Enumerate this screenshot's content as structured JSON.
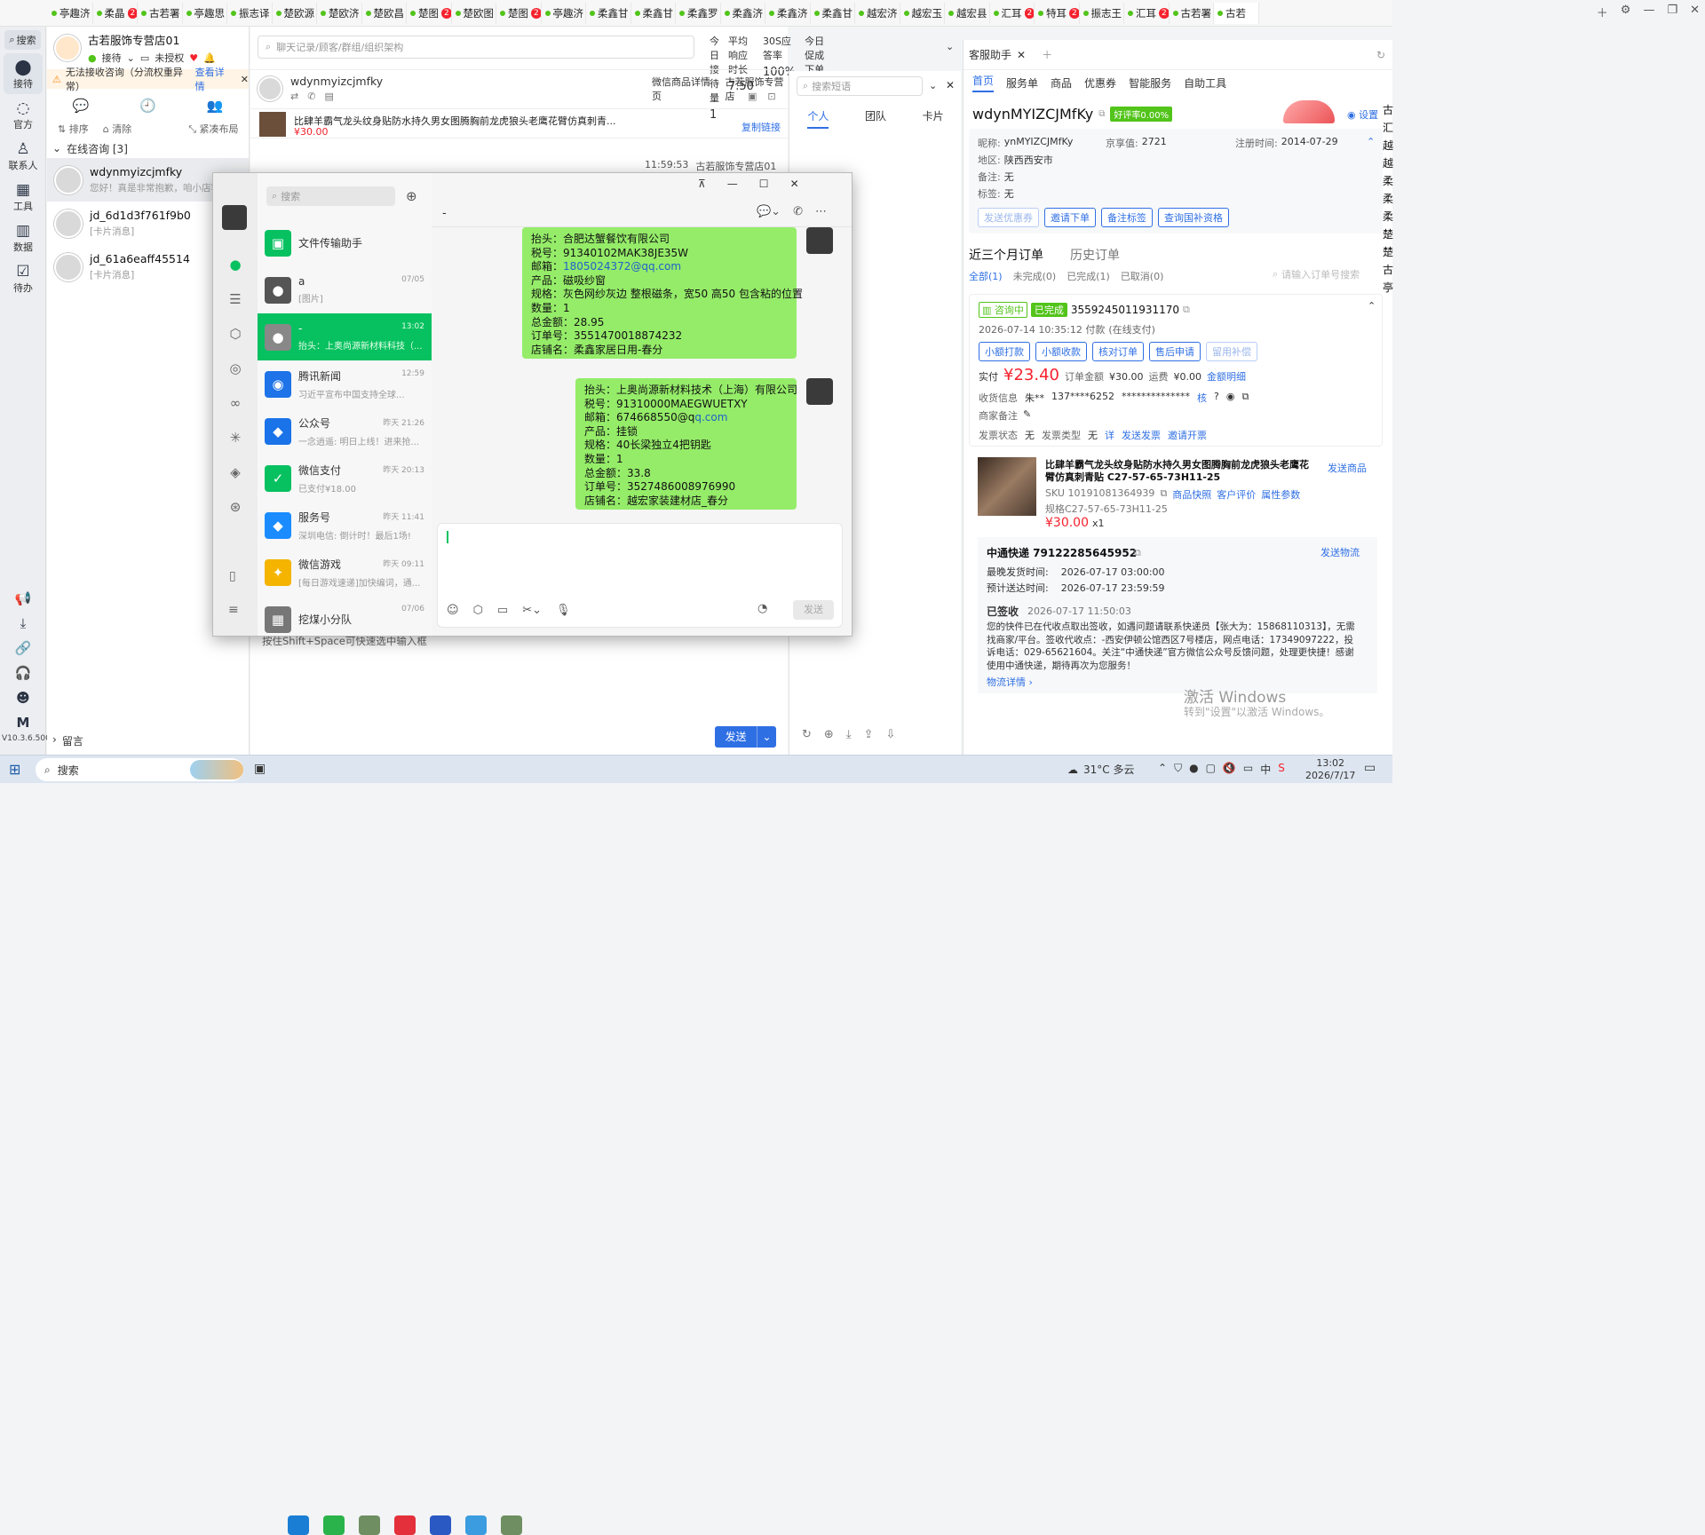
{
  "tabs": [
    {
      "label": "亭趣济",
      "badge": ""
    },
    {
      "label": "柔晶",
      "badge": "2"
    },
    {
      "label": "古若署",
      "badge": ""
    },
    {
      "label": "亭趣思",
      "badge": ""
    },
    {
      "label": "振志译",
      "badge": ""
    },
    {
      "label": "楚欧源",
      "badge": ""
    },
    {
      "label": "楚欧济",
      "badge": ""
    },
    {
      "label": "楚欧昌",
      "badge": ""
    },
    {
      "label": "楚图",
      "badge": "2"
    },
    {
      "label": "楚欧图",
      "badge": ""
    },
    {
      "label": "楚图",
      "badge": "2"
    },
    {
      "label": "亭趣济",
      "badge": ""
    },
    {
      "label": "柔鑫甘",
      "badge": ""
    },
    {
      "label": "柔鑫甘",
      "badge": ""
    },
    {
      "label": "柔鑫罗",
      "badge": ""
    },
    {
      "label": "柔鑫济",
      "badge": ""
    },
    {
      "label": "柔鑫济",
      "badge": ""
    },
    {
      "label": "柔鑫甘",
      "badge": ""
    },
    {
      "label": "越宏济",
      "badge": ""
    },
    {
      "label": "越宏玉",
      "badge": ""
    },
    {
      "label": "越宏县",
      "badge": ""
    },
    {
      "label": "汇耳",
      "badge": "2"
    },
    {
      "label": "特耳",
      "badge": "2"
    },
    {
      "label": "振志王",
      "badge": ""
    },
    {
      "label": "汇耳",
      "badge": "2"
    },
    {
      "label": "古若署",
      "badge": ""
    },
    {
      "label": "古若",
      "badge": ""
    }
  ],
  "leftnav": {
    "search": "搜索",
    "items": [
      "接待",
      "官方",
      "联系人",
      "工具",
      "数据",
      "待办"
    ],
    "version": "V10.3.6.500"
  },
  "shop": {
    "name": "古若服饰专营店01",
    "status": "接待",
    "auth": "未授权",
    "alert": "无法接收咨询（分流权重异常）",
    "alert_link": "查看详情",
    "sort": "排序",
    "clear": "清除",
    "layout": "紧凑布局",
    "section": "在线咨询 [3]",
    "leave": "留言"
  },
  "conversations": [
    {
      "name": "wdynmyizcjmfky",
      "preview": "您好！真是非常抱歉，咱小店客"
    },
    {
      "name": "jd_6d1d3f761f9b0",
      "preview": "[卡片消息]"
    },
    {
      "name": "jd_61a6eaff45514",
      "preview": "[卡片消息]"
    }
  ],
  "chat": {
    "search_placeholder": "聊天记录/顾客/群组/组织架构",
    "user": "wdynmyizcjmfky",
    "link1": "微信商品详情页",
    "link2": "古若服饰专营店",
    "product_title": "比肆羊霸气龙头纹身贴防水持久男女图腾胸前龙虎狼头老鹰花臂仿真刺青...",
    "product_price": "¥30.00",
    "copy_link": "复制链接",
    "time": "11:59:53",
    "sender": "古若服饰专营店01",
    "hint": "按住Shift+Space可快速选中输入框",
    "send": "发送"
  },
  "stats": [
    {
      "label": "今日接待量",
      "value": "1"
    },
    {
      "label": "平均响应时长",
      "value": "7.50"
    },
    {
      "label": "30S应答率",
      "value": "100%"
    },
    {
      "label": "今日促成下单金额",
      "value": "0.00"
    }
  ],
  "quick": {
    "placeholder": "搜索短语",
    "tabs": [
      "个人",
      "团队",
      "卡片"
    ]
  },
  "assistant": {
    "tab": "客服助手",
    "nav": [
      "首页",
      "服务单",
      "商品",
      "优惠券",
      "智能服务",
      "自助工具"
    ],
    "settings": "设置",
    "customer": "wdynMYIZCJMfKy",
    "rate": "好评率0.00%",
    "nick_label": "昵称:",
    "nick": "ynMYIZCJMfKy",
    "jx_label": "京享值:",
    "jx": "2721",
    "reg_label": "注册时间:",
    "reg": "2014-07-29",
    "area_label": "地区:",
    "area": "陕西西安市",
    "note_label": "备注:",
    "note": "无",
    "tag_label": "标签:",
    "tag": "无",
    "buttons": [
      "发送优惠券",
      "邀请下单",
      "备注标签",
      "查询国补资格"
    ],
    "orders_tab": "近三个月订单",
    "history_tab": "历史订单",
    "filters": [
      "全部(1)",
      "未完成(0)",
      "已完成(1)",
      "已取消(0)"
    ],
    "order_search": "请输入订单号搜索",
    "consult": "咨询中",
    "done": "已完成",
    "order_no": "3559245011931170",
    "order_time": "2026-07-14 10:35:12 付款",
    "order_pay": "(在线支付)",
    "order_btns": [
      "小额打款",
      "小额收款",
      "核对订单",
      "售后申请",
      "留用补偿"
    ],
    "paid_label": "实付",
    "paid": "¥23.40",
    "amount_label": "订单金额",
    "amount": "¥30.00",
    "ship_label": "运费",
    "ship": "¥0.00",
    "detail": "金额明细",
    "recv_label": "收货信息",
    "recv_name": "朱**",
    "recv_phone": "137****6252",
    "recv_addr": "**************",
    "merchant_note": "商家备注",
    "inv_status_label": "发票状态",
    "inv_status": "无",
    "inv_type_label": "发票类型",
    "inv_type": "无",
    "inv_send": "发送发票",
    "inv_invite": "邀请开票",
    "item_title": "比肆羊霸气龙头纹身贴防水持久男女图腾胸前龙虎狼头老鹰花臂仿真刺青贴 C27-57-65-73H11-25",
    "send_item": "发送商品",
    "sku": "SKU 10191081364939",
    "snap": "商品快照",
    "review": "客户评价",
    "attr": "属性参数",
    "spec": "规格C27-57-65-73H11-25",
    "item_price": "¥30.00",
    "qty": "x1",
    "express": "中通快递 79122285645952",
    "send_logistics": "发送物流",
    "latest_ship_label": "最晚发货时间:",
    "latest_ship": "2026-07-17 03:00:00",
    "eta_label": "预计送达时间:",
    "eta": "2026-07-17 23:59:59",
    "signed": "已签收",
    "signed_time": "2026-07-17 11:50:03",
    "signed_text": "您的快件已在代收点取出签收，如遇问题请联系快递员【张大为：15868110313】，无需找商家/平台。签收代收点：-西安伊顿公馆西区7号楼店，网点电话：17349097222，投诉电话：029-65621604。关注“中通快递”官方微信公众号反馈问题，处理更快捷！感谢使用中通快递，期待再次为您服务！",
    "logistics_detail": "物流详情"
  },
  "right_edge": [
    "古",
    "汇",
    "越",
    "越",
    "柔",
    "柔",
    "柔",
    "楚",
    "楚",
    "古",
    "亭"
  ],
  "wechat": {
    "search": "搜索",
    "chat_title": "-",
    "list": [
      {
        "name": "文件传输助手",
        "time": "",
        "preview": "",
        "color": "#07c160",
        "glyph": "▣"
      },
      {
        "name": "a",
        "time": "07/05",
        "preview": "[图片]",
        "color": "#555",
        "glyph": "●"
      },
      {
        "name": "-",
        "time": "13:02",
        "preview": "抬头：上奥尚源新材料科技（...",
        "color": "#888",
        "glyph": "●"
      },
      {
        "name": "腾讯新闻",
        "time": "12:59",
        "preview": "习近平宣布中国支持全球...",
        "color": "#1e73e8",
        "glyph": "◉"
      },
      {
        "name": "公众号",
        "time": "昨天 21:26",
        "preview": "一念逍遥: 明日上线！进来抢...",
        "color": "#1a73e8",
        "glyph": "◆"
      },
      {
        "name": "微信支付",
        "time": "昨天 20:13",
        "preview": "已支付¥18.00",
        "color": "#07c160",
        "glyph": "✓"
      },
      {
        "name": "服务号",
        "time": "昨天 11:41",
        "preview": "深圳电信: 倒计时！最后1场!",
        "color": "#1a8cff",
        "glyph": "◆"
      },
      {
        "name": "微信游戏",
        "time": "昨天 09:11",
        "preview": "[每日游戏速递]加快编词，通...",
        "color": "#f4b400",
        "glyph": "✦"
      },
      {
        "name": "挖煤小分队",
        "time": "07/06",
        "preview": "",
        "color": "#777",
        "glyph": "▦"
      }
    ],
    "msg1": [
      "抬头：合肥达蟹餐饮有限公司",
      "税号：91340102MAK38JE35W",
      "邮箱：",
      "产品：磁吸纱窗",
      "规格：灰色网纱灰边 整根磁条，宽50 高50 包含粘的位置",
      "数量：1",
      "总金额：28.95",
      "订单号：3551470018874232",
      "店铺名：柔鑫家居日用-春分"
    ],
    "msg1_email": "1805024372@qq.com",
    "msg2": [
      "抬头：上奥尚源新材料技术（上海）有限公司",
      "税号：91310000MAEGWUETXY",
      "邮箱：674668550@q",
      "产品：挂锁",
      "规格：40长梁独立4把钥匙",
      "数量：1",
      "总金额：33.8",
      "订单号：3527486008976990",
      "店铺名：越宏家装建材店_春分"
    ],
    "msg2_email": "q.com",
    "send": "发送"
  },
  "watermark": {
    "line1": "激活 Windows",
    "line2": "转到\"设置\"以激活 Windows。"
  },
  "taskbar": {
    "search": "搜索",
    "weather": "31°C 多云",
    "time": "13:02",
    "date": "2026/7/17",
    "ime": "中"
  }
}
